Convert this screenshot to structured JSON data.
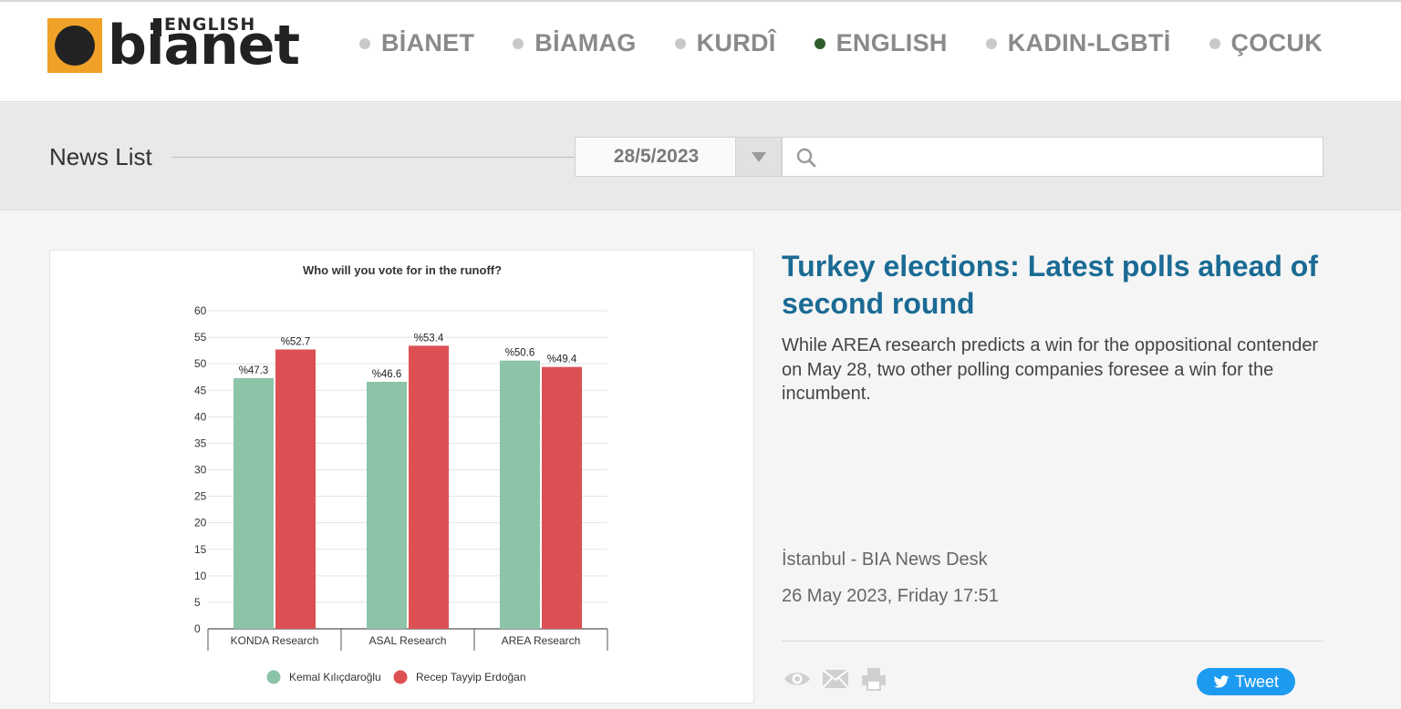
{
  "logo": {
    "english": "ENGLISH",
    "word": "bianet"
  },
  "nav": {
    "items": [
      {
        "label": "BİANET",
        "active": false
      },
      {
        "label": "BİAMAG",
        "active": false
      },
      {
        "label": "KURDÎ",
        "active": false
      },
      {
        "label": "ENGLISH",
        "active": true
      },
      {
        "label": "KADIN-LGBTİ",
        "active": false
      },
      {
        "label": "ÇOCUK",
        "active": false
      }
    ]
  },
  "listbar": {
    "title": "News List",
    "date": "28/5/2023",
    "search_placeholder": ""
  },
  "article": {
    "headline": "Turkey elections: Latest polls ahead of second round",
    "summary": "While AREA research predicts a win for the oppositional contender on May 28, two other polling companies foresee a win for the incumbent.",
    "location": "İstanbul - BIA News Desk",
    "date": "26 May 2023, Friday 17:51",
    "tweet_label": "Tweet"
  },
  "colors": {
    "accent": "#1a6b94",
    "logo_orange": "#f0a128",
    "active_nav": "#2d5e2b",
    "series_green": "#8cc4a8",
    "series_red": "#dc5054",
    "tweet_blue": "#1d9bf0"
  },
  "chart_data": {
    "type": "bar",
    "title": "Who will you vote for in the runoff?",
    "categories": [
      "KONDA Research",
      "ASAL Research",
      "AREA Research"
    ],
    "series": [
      {
        "name": "Kemal Kılıçdaroğlu",
        "color": "#8cc4a8",
        "values": [
          47.3,
          46.6,
          50.6
        ],
        "labels": [
          "%47.3",
          "%46.6",
          "%50.6"
        ]
      },
      {
        "name": "Recep Tayyip Erdoğan",
        "color": "#dc5054",
        "values": [
          52.7,
          53.4,
          49.4
        ],
        "labels": [
          "%52.7",
          "%53.4",
          "%49.4"
        ]
      }
    ],
    "ylim": [
      0,
      60
    ],
    "yticks": [
      0,
      5,
      10,
      15,
      20,
      25,
      30,
      35,
      40,
      45,
      50,
      55,
      60
    ],
    "grid": true,
    "legend": "bottom"
  }
}
